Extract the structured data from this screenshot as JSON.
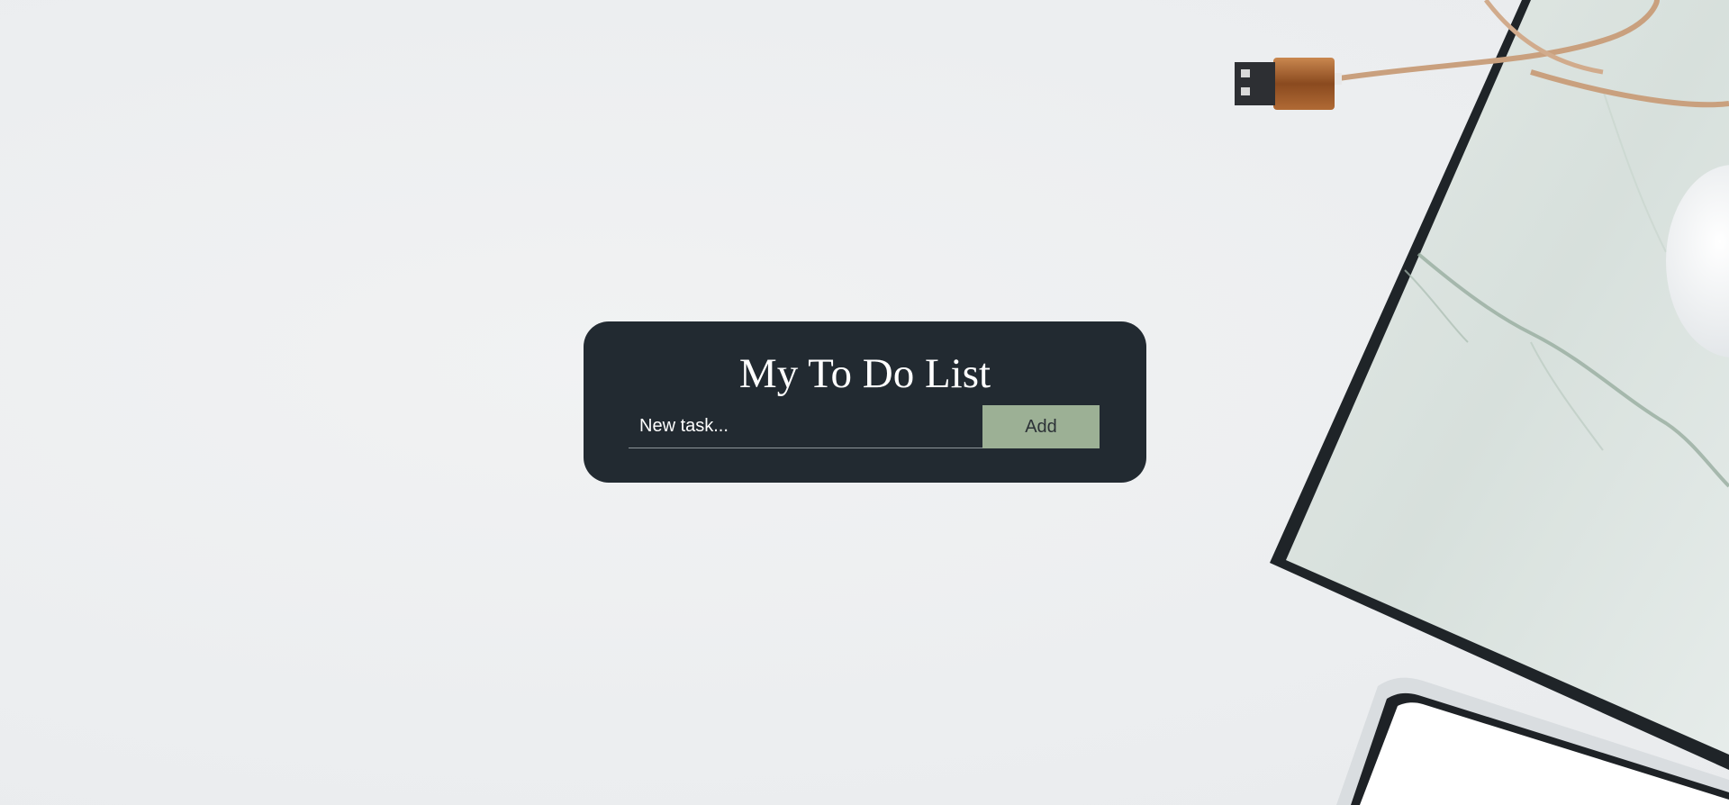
{
  "todo": {
    "title": "My To Do List",
    "input_placeholder": "New task...",
    "input_value": "",
    "add_label": "Add"
  },
  "theme": {
    "card_background": "#222a31",
    "button_background": "#9cb095",
    "page_background": "#eef0f1"
  },
  "icons": [
    "usb-cable-icon",
    "marble-mousepad-icon",
    "mouse-icon",
    "phone-icon"
  ]
}
